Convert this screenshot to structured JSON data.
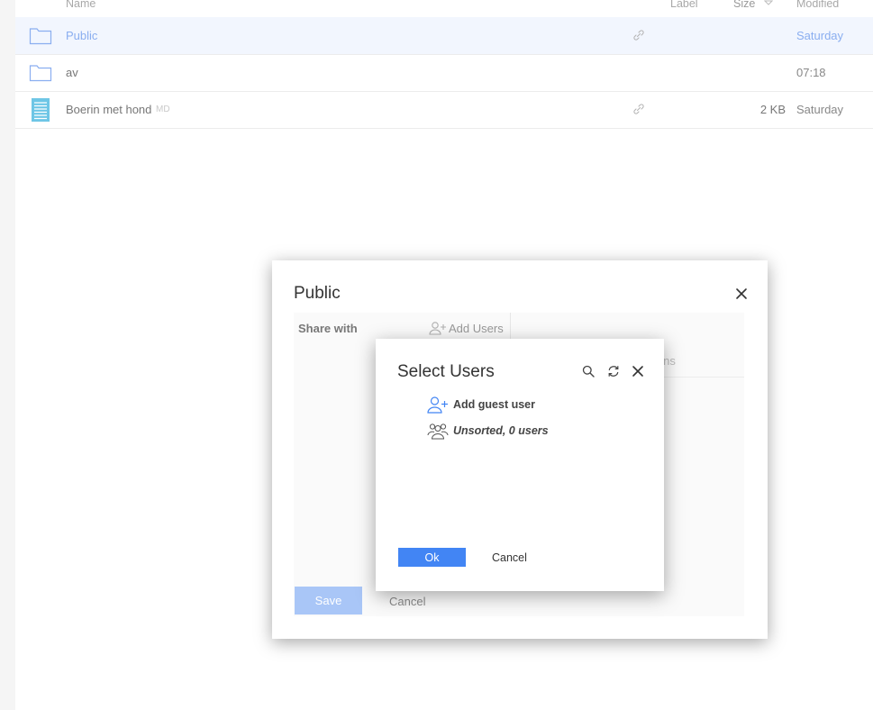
{
  "file_list": {
    "columns": {
      "name": "Name",
      "label": "Label",
      "size": "Size",
      "modified": "Modified"
    },
    "rows": [
      {
        "name": "Public",
        "ext": "",
        "type": "folder",
        "shared": true,
        "size": "",
        "modified": "Saturday",
        "selected": true
      },
      {
        "name": "av",
        "ext": "",
        "type": "folder",
        "shared": false,
        "size": "",
        "modified": "07:18",
        "selected": false
      },
      {
        "name": "Boerin met hond",
        "ext": "MD",
        "type": "document",
        "shared": true,
        "size": "2 KB",
        "modified": "Saturday",
        "selected": false
      }
    ]
  },
  "share_dialog": {
    "title": "Public",
    "share_with_label": "Share with",
    "add_users_label": "Add Users",
    "options_tab_label": "ions",
    "save_label": "Save",
    "cancel_label": "Cancel"
  },
  "select_users_dialog": {
    "title": "Select Users",
    "options": [
      {
        "label": "Add guest user",
        "icon": "add-user-icon"
      },
      {
        "label": "Unsorted, 0 users",
        "icon": "user-group-icon"
      }
    ],
    "ok_label": "Ok",
    "cancel_label": "Cancel"
  },
  "colors": {
    "accent": "#4285f4",
    "accent_disabled": "#a9c6f7",
    "selected_row": "#f2f6fe",
    "folder_icon": "#8aaef0",
    "document_icon": "#6ec6e6"
  }
}
